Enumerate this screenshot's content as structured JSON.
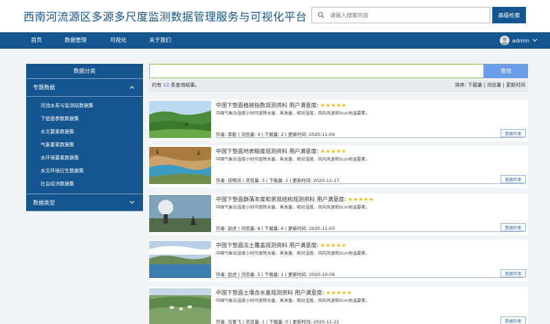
{
  "header": {
    "title": "西南河流源区多源多尺度监测数据管理服务与可视化平台",
    "search_placeholder": "请输入搜索内容",
    "advanced_search_label": "高级检索"
  },
  "nav": {
    "items": [
      "首页",
      "数据管理",
      "可视化",
      "关于我们"
    ],
    "username": "admin"
  },
  "sidebar": {
    "title": "数据分类",
    "group1": "专题数据",
    "group1_items": [
      "河流水系与监测站数据集",
      "下垫面参数数据集",
      "水文要素数据集",
      "气象要素数据集",
      "水环境要素数据集",
      "水文环境衍生数据集",
      "社会经济数据集"
    ],
    "group2": "数据类型"
  },
  "main": {
    "search_value": "",
    "find_label": "查找",
    "result_prefix": "约有",
    "result_count": "12",
    "result_suffix": "条查询结果。",
    "sort_label": "排序:",
    "sort_options": [
      "下载量",
      "浏览量",
      "更新时间"
    ]
  },
  "card_common": {
    "rating_label": "用户满意度:",
    "description": "中国气象站湿度小时尺度降水量、蒸发量、相对湿度、风向风速和0cm地温要素。",
    "button_label": "数据检索"
  },
  "cards": [
    {
      "title": "中国下垫面植被指数观测资料",
      "stars": "★★★★★",
      "meta": "作者: 李毅 | 浏览量: 4 | 下载量: 2 | 更新时间: 2020-11-09"
    },
    {
      "title": "中国下垫面地表糙度观测资料",
      "stars": "★★★★★",
      "meta": "作者: 该明洪 | 浏览量: 3 | 下载量: 2 | 更新时间: 2020-11-17"
    },
    {
      "title": "中国下垫面群落丰度和景观结构观测资料",
      "stars": "★★★★★",
      "meta": "作者: 赵虎 | 浏览量: 8 | 下载量: 6 | 更新时间: 2020-11-03"
    },
    {
      "title": "中国下垫面冻土覆盖观测资料",
      "stars": "★★★★★",
      "meta": "作者: 赵虎 | 浏览量: 5 | 下载量: 1 | 更新时间: 2020-10-08"
    },
    {
      "title": "中国下垫面土壤含水量观测资料",
      "stars": "★★★★★",
      "meta": "作者: 马晋飞 | 浏览量: 1 | 下载量: 0 | 更新时间: 2020-11-21"
    }
  ]
}
